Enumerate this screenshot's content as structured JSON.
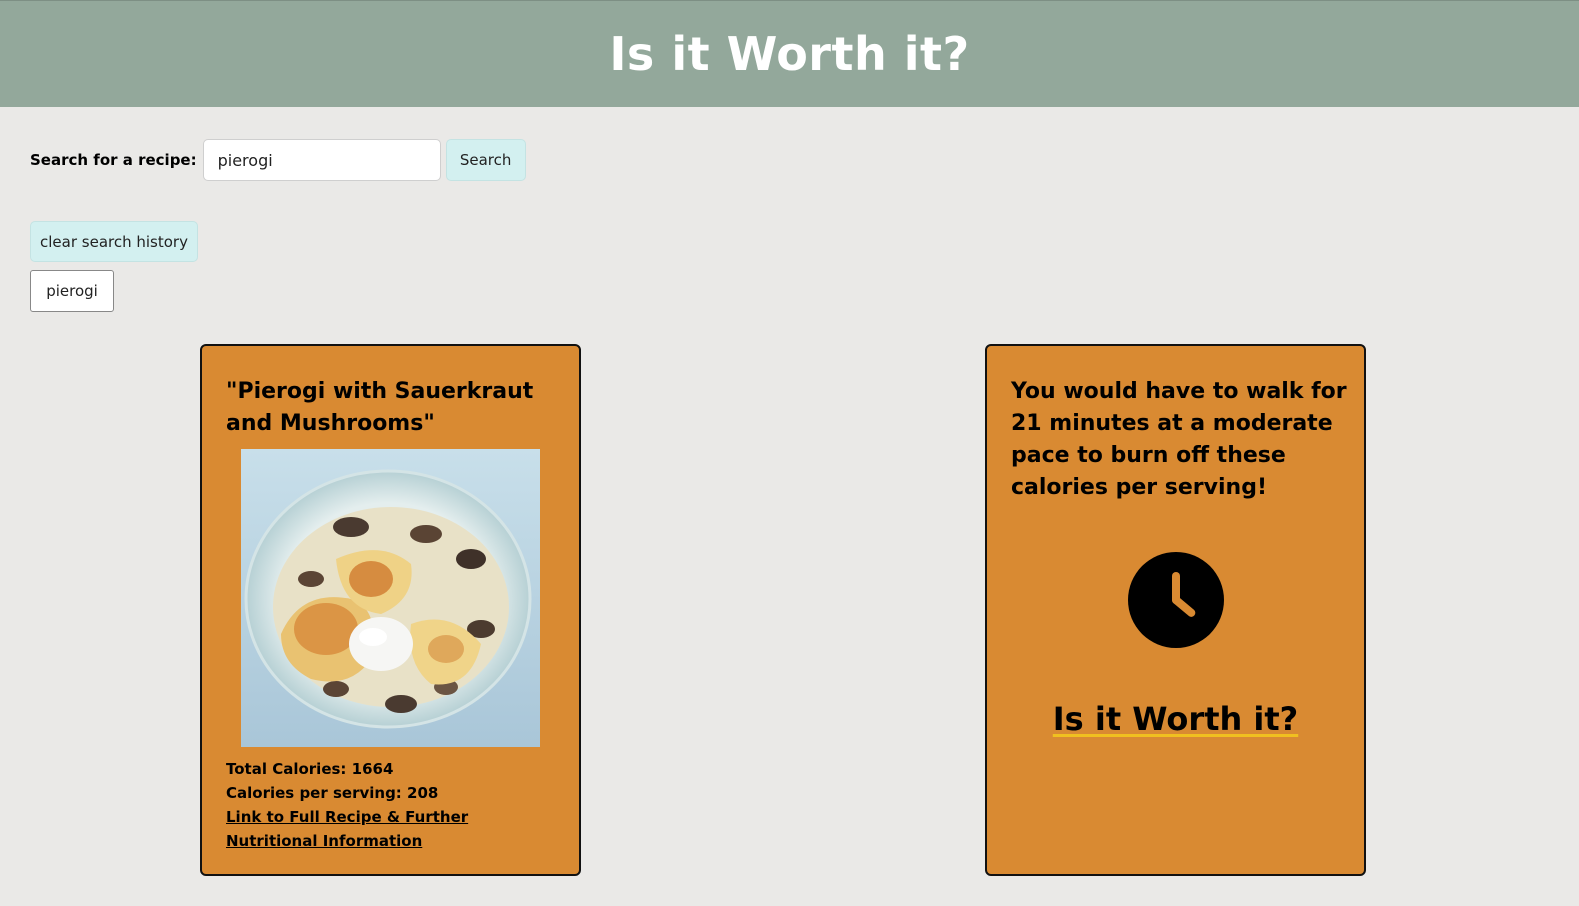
{
  "header": {
    "title": "Is it Worth it?"
  },
  "search": {
    "label": "Search for a recipe:",
    "value": "pierogi",
    "button_label": "Search"
  },
  "history": {
    "clear_label": "clear search history",
    "items": [
      "pierogi"
    ]
  },
  "recipe_card": {
    "title": "\"Pierogi with Sauerkraut and Mushrooms\"",
    "total_calories": "Total Calories: 1664",
    "calories_per_serving": "Calories per serving: 208",
    "link_text": "Link to Full Recipe & Further Nutritional Information"
  },
  "walk_card": {
    "message": "You would have to walk for 21 minutes at a moderate pace to burn off these calories per serving!",
    "icon": "clock-icon",
    "worth_link": "Is it Worth it?"
  },
  "colors": {
    "header_bg": "#93a89b",
    "page_bg": "#eae9e7",
    "card_bg": "#d98a32",
    "button_teal": "#d3f0f0",
    "link_underline": "#f0c020"
  }
}
